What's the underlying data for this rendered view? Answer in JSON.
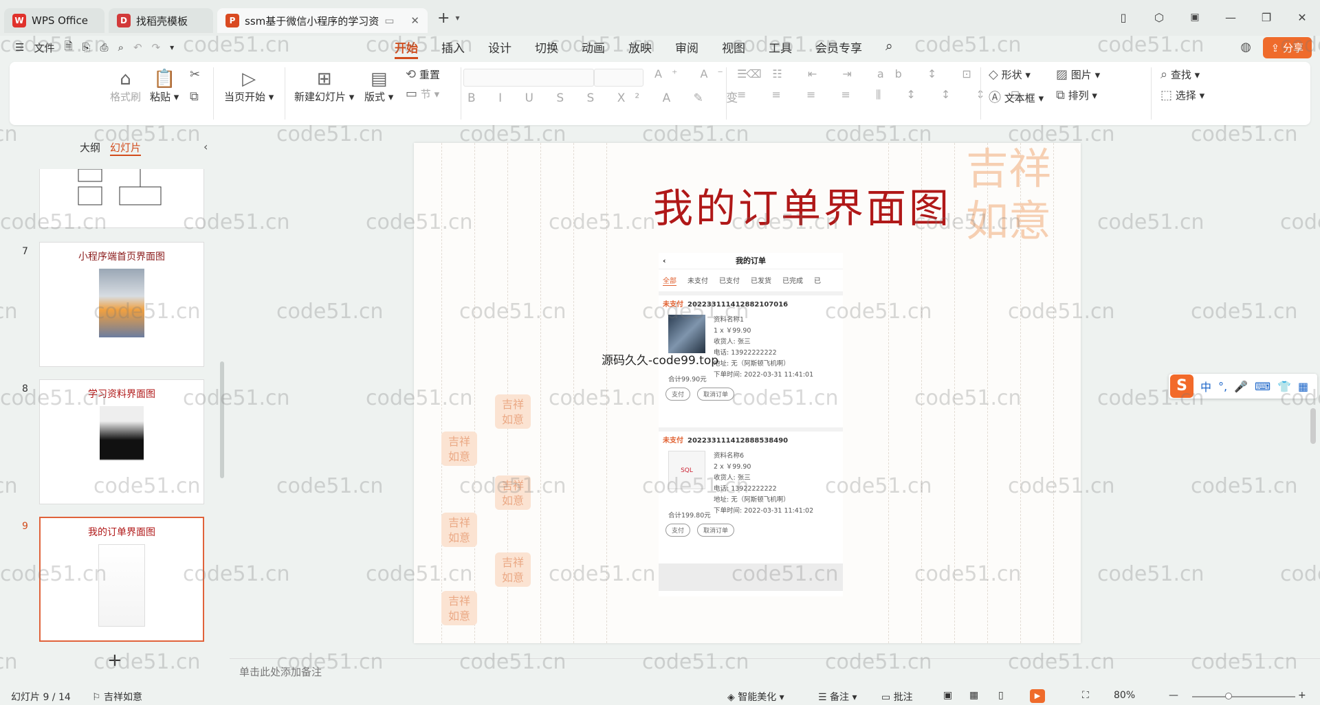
{
  "titlebar": {
    "tabs": [
      {
        "label": "WPS Office",
        "logo": "W",
        "logo_color": "#e0322c"
      },
      {
        "label": "找稻壳模板",
        "logo": "D",
        "logo_color": "#d23a3a"
      },
      {
        "label": "ssm基于微信小程序的学习资",
        "logo": "P",
        "logo_color": "#d94a21"
      }
    ],
    "new_tab": "+",
    "window_buttons": [
      "—",
      "❐",
      "✕"
    ]
  },
  "menubar": {
    "file_label": "文件",
    "tabs": [
      "开始",
      "插入",
      "设计",
      "切换",
      "动画",
      "放映",
      "审阅",
      "视图",
      "工具",
      "会员专享"
    ],
    "selected_tab": "开始",
    "share_label": "分享"
  },
  "ribbon": {
    "format_painter": "格式刷",
    "paste": "粘贴",
    "play_from_current": "当页开始",
    "new_slide": "新建幻灯片",
    "layout": "版式",
    "reset": "重置",
    "section": "节",
    "shape": "形状",
    "picture": "图片",
    "textbox": "文本框",
    "arrange": "排列",
    "find": "查找",
    "select": "选择"
  },
  "left_panel": {
    "tabs": [
      "大纲",
      "幻灯片"
    ],
    "selected_tab": "幻灯片",
    "thumbnails": [
      {
        "num": "7",
        "title": "小程序端首页界面图"
      },
      {
        "num": "8",
        "title": "学习资料界面图"
      },
      {
        "num": "9",
        "title": "我的订单界面图"
      }
    ],
    "add_slide": "+"
  },
  "slide": {
    "title": "我的订单界面图",
    "seal_text": "吉祥如意",
    "overlay_text": "源码久久-code99.top",
    "phone": {
      "header": "我的订单",
      "tabs": [
        "全部",
        "未支付",
        "已支付",
        "已发货",
        "已完成",
        "已"
      ],
      "selected_tab": "全部",
      "orders": [
        {
          "status": "未支付",
          "order_no": "20223311141288210701​6",
          "name": "资料名称1",
          "qty_price": "1 x ￥99.90",
          "receiver": "收货人: 张三",
          "phone": "电话: 13922222222",
          "address": "地址: 无（阿斯顿飞机啊）",
          "time": "下单时间: 2022-03-31 11:41:01",
          "total": "合计99.90元",
          "pay": "支付",
          "cancel": "取消订单"
        },
        {
          "status": "未支付",
          "order_no": "20223311141288853849​0",
          "name": "资料名称6",
          "qty_price": "2 x ￥99.90",
          "receiver": "收货人: 张三",
          "phone": "电话: 13922222222",
          "address": "地址: 无（阿斯顿飞机啊）",
          "time": "下单时间: 2022-03-31 11:41:02",
          "total": "合计199.80元",
          "pay": "支付",
          "cancel": "取消订单"
        }
      ]
    }
  },
  "notes_placeholder": "单击此处添加备注",
  "statusbar": {
    "slide_count": "幻灯片 9 / 14",
    "theme": "吉祥如意",
    "beautify": "智能美化",
    "notes": "备注",
    "comments": "批注",
    "zoom": "80%"
  },
  "ime": {
    "logo": "S",
    "mode": "中"
  },
  "watermark": "code51.cn"
}
